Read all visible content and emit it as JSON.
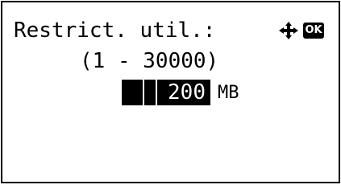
{
  "screen": {
    "title": "Restrict. util.:",
    "range": "(1 - 30000)",
    "value": "200",
    "unit": "MB"
  },
  "nav": {
    "icon": "four-way-arrow-icon",
    "ok_label": "OK"
  },
  "colors": {
    "foreground": "#000000",
    "background": "#ffffff",
    "highlight_text": "#ffffff"
  }
}
